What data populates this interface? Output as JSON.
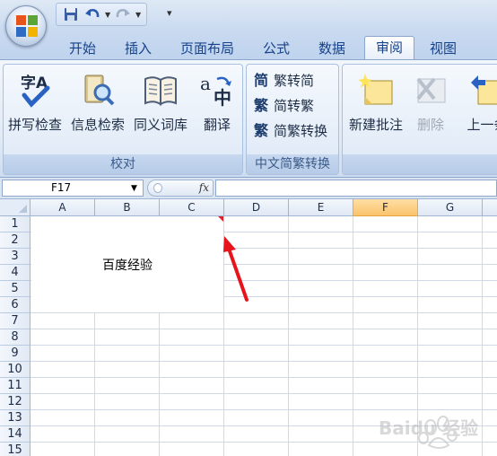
{
  "quick_access": {
    "save_icon": "save-icon",
    "undo_icon": "undo-icon",
    "redo_icon": "redo-icon"
  },
  "tabs": [
    {
      "label": "开始"
    },
    {
      "label": "插入"
    },
    {
      "label": "页面布局"
    },
    {
      "label": "公式"
    },
    {
      "label": "数据"
    },
    {
      "label": "审阅",
      "active": true
    },
    {
      "label": "视图"
    }
  ],
  "ribbon": {
    "proofing": {
      "label": "校对",
      "spellcheck": "拼写检查",
      "research": "信息检索",
      "thesaurus": "同义词库",
      "translate": "翻译"
    },
    "chinese_conversion": {
      "label": "中文简繁转换",
      "to_traditional": "繁转简",
      "to_simplified": "简转繁",
      "convert": "简繁转换"
    },
    "comments": {
      "new_comment": "新建批注",
      "delete": "删除",
      "previous": "上一条"
    },
    "colors": {
      "accent": "#15428b",
      "selected_col": "#f9c36b",
      "arrow": "#e8141c"
    }
  },
  "formula_bar": {
    "name_box": "F17",
    "fx_label": "fx",
    "formula": ""
  },
  "sheet": {
    "columns": [
      "A",
      "B",
      "C",
      "D",
      "E",
      "F",
      "G"
    ],
    "selected_column": "F",
    "rows": [
      "1",
      "2",
      "3",
      "4",
      "5",
      "6",
      "7",
      "8",
      "9",
      "10",
      "11",
      "12",
      "13",
      "14",
      "15"
    ],
    "merged_cell_text": "百度经验"
  },
  "watermark": "Baidu 经验"
}
